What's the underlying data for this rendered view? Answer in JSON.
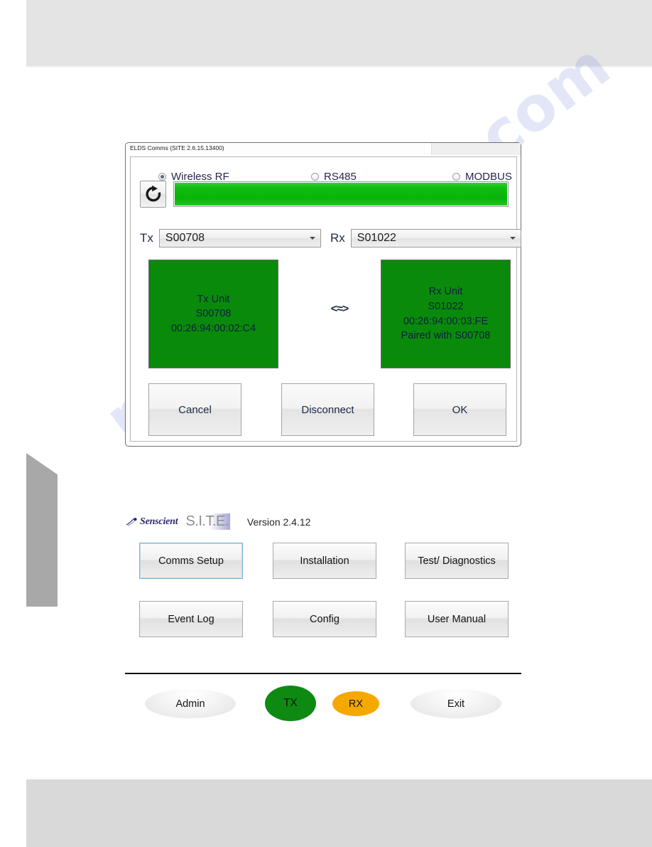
{
  "dialog": {
    "title": "ELDS Comms (SITE 2.6.15.13400)",
    "connection_modes": [
      {
        "label": "Wireless RF",
        "selected": true
      },
      {
        "label": "RS485",
        "selected": false
      },
      {
        "label": "MODBUS",
        "selected": false
      }
    ],
    "refresh_icon": "refresh-circular-arrow-icon",
    "progress": {
      "value": 100,
      "color": "#12be12"
    },
    "tx_select": {
      "label": "Tx",
      "value": "S00708"
    },
    "rx_select": {
      "label": "Rx",
      "value": "S01022"
    },
    "tx_panel": {
      "title": "Tx Unit",
      "serial": "S00708",
      "mac": "00:26:94:00:02:C4",
      "color": "#0a8a0a"
    },
    "rx_panel": {
      "title": "Rx Unit",
      "serial": "S01022",
      "mac": "00:26:94:00:03:FE",
      "paired": "Paired with S00708",
      "color": "#0a8a0a"
    },
    "link_symbol": "<≈>",
    "buttons": {
      "cancel": "Cancel",
      "disconnect": "Disconnect",
      "ok": "OK"
    }
  },
  "app": {
    "brand": {
      "company": "Senscient",
      "product": "S.I.T.E.",
      "version": "Version 2.4.12"
    },
    "menu_buttons": [
      {
        "label": "Comms Setup",
        "focused": true
      },
      {
        "label": "Installation",
        "focused": false
      },
      {
        "label": "Test/ Diagnostics",
        "focused": false
      },
      {
        "label": "Event Log",
        "focused": false
      },
      {
        "label": "Config",
        "focused": false
      },
      {
        "label": "User Manual",
        "focused": false
      }
    ],
    "pills": [
      {
        "label": "Admin",
        "color": "#eeeeee"
      },
      {
        "label": "TX",
        "color": "#0e8a12"
      },
      {
        "label": "RX",
        "color": "#f5a800"
      },
      {
        "label": "Exit",
        "color": "#eeeeee"
      }
    ]
  },
  "page": {
    "watermark": "manualshive.com"
  }
}
